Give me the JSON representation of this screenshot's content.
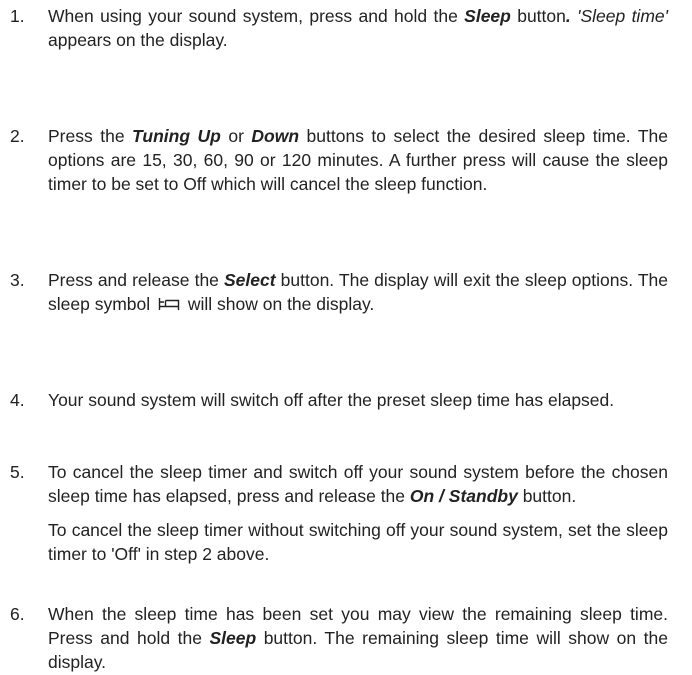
{
  "steps": [
    {
      "number": "1.",
      "parts": [
        {
          "t": "When using your sound system, press and hold the "
        },
        {
          "t": "Sleep",
          "s": "bi"
        },
        {
          "t": " button"
        },
        {
          "t": ".",
          "s": "bi"
        },
        {
          "t": " "
        },
        {
          "t": "'Sleep time'",
          "s": "it"
        },
        {
          "t": " appears on the display."
        }
      ]
    },
    {
      "number": "2.",
      "parts": [
        {
          "t": "Press the "
        },
        {
          "t": "Tuning Up",
          "s": "bi"
        },
        {
          "t": " or "
        },
        {
          "t": "Down",
          "s": "bi"
        },
        {
          "t": " buttons to select the desired sleep time. The options are 15, 30, 60, 90 or 120 minutes. A further press will cause the sleep timer to be set to Off which will cancel the sleep function."
        }
      ]
    },
    {
      "number": "3.",
      "parts": [
        {
          "t": "Press and release the "
        },
        {
          "t": "Select",
          "s": "bi"
        },
        {
          "t": " button. The display will exit the sleep options. The sleep symbol "
        },
        {
          "icon": "sleep-symbol-icon"
        },
        {
          "t": " will show on the display."
        }
      ]
    },
    {
      "number": "4.",
      "parts": [
        {
          "t": "Your sound system will switch off after the preset sleep time has elapsed."
        }
      ]
    },
    {
      "number": "5.",
      "parts": [
        {
          "t": "To cancel the sleep timer and switch off your sound system before the chosen sleep time has elapsed, press and release the "
        },
        {
          "t": "On / Standby",
          "s": "bi"
        },
        {
          "t": " button."
        }
      ],
      "extra": "To cancel the sleep timer without switching off your sound system, set the sleep timer to 'Off' in step 2 above."
    },
    {
      "number": "6.",
      "parts": [
        {
          "t": "When the sleep time has been set you may view the remaining sleep time. Press and hold the "
        },
        {
          "t": "Sleep",
          "s": "bi"
        },
        {
          "t": " button. The remaining sleep time will show on the display."
        }
      ]
    }
  ]
}
